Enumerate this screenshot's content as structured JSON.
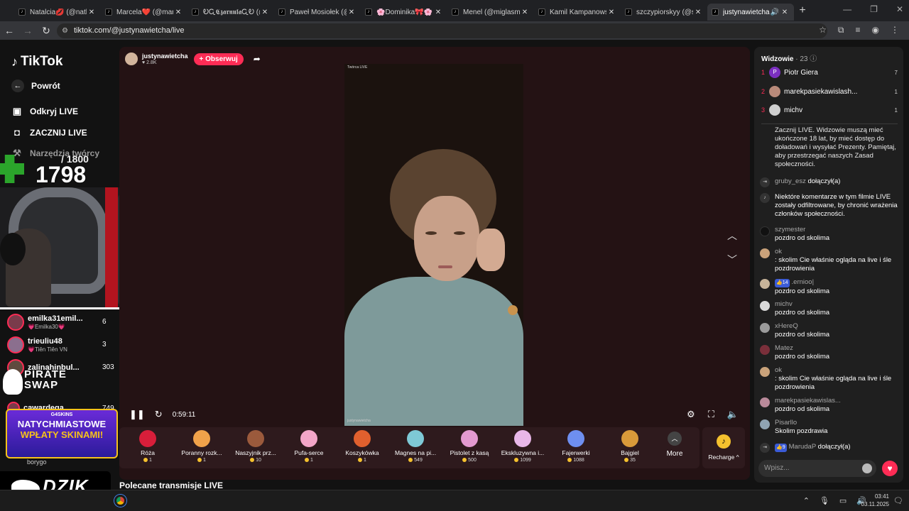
{
  "browser": {
    "tabs": [
      {
        "label": "Natalcia💋 (@natka"
      },
      {
        "label": "Marcela❤️ (@marcel"
      },
      {
        "label": "ᎧᏩ𝕮𝖟𝖆𝖗𝖓𝖚𝖑𝖆ᏩᎧ (@"
      },
      {
        "label": "Paweł Mosiołek (@pa"
      },
      {
        "label": "🌸Dominika🎀🌸"
      },
      {
        "label": "Menel (@miglasmig"
      },
      {
        "label": "Kamil Kampanowski ("
      },
      {
        "label": "szczypiorskyy (@szcz"
      },
      {
        "label": "justynawietcha (@"
      }
    ],
    "url": "tiktok.com/@justynawietcha/live"
  },
  "sidebar": {
    "logo": "TikTok",
    "back": "Powrót",
    "nav": [
      {
        "label": "Odkryj LIVE"
      },
      {
        "label": "ZACZNIJ LIVE"
      },
      {
        "label": "Narzędzia twórcy"
      }
    ],
    "counter_target": "/ 1800",
    "counter_value": "1798",
    "live_users": [
      {
        "name": "emilka31emil...",
        "sub": "💗Emilka30💗",
        "count": "6"
      },
      {
        "name": "trieuliu48",
        "sub": "💗Tiên Tiên VN",
        "count": "3"
      },
      {
        "name": "zalinahinbul...",
        "sub": "",
        "count": "303"
      },
      {
        "name": "cawardega",
        "sub": "",
        "count": "749"
      }
    ],
    "pirate_line1": "PIRATE",
    "pirate_line2": "SWAP",
    "banner_brand": "G4SKINS",
    "banner_line1": "NATYCHMIASTOWE",
    "banner_line2": "WPŁATY SKINAMI!",
    "borygo": "borygo",
    "dzik": "DZIK."
  },
  "stream": {
    "host_name": "justynawietcha",
    "host_likes": "♥ 2.8K",
    "follow": "+ Obserwuj",
    "badge": "Twórca LIVE",
    "credit": "justynawietcha",
    "time": "0:59:11"
  },
  "gifts": [
    {
      "name": "Róża",
      "price": "1",
      "color": "#d81e3a"
    },
    {
      "name": "Poranny rozk...",
      "price": "1",
      "color": "#f0a24a"
    },
    {
      "name": "Naszyjnik prz...",
      "price": "10",
      "color": "#9b5a3c"
    },
    {
      "name": "Pufa-serce",
      "price": "1",
      "color": "#f3a6c8"
    },
    {
      "name": "Koszykówka",
      "price": "1",
      "color": "#e0602e"
    },
    {
      "name": "Magnes na pi...",
      "price": "549",
      "color": "#7ec9d6"
    },
    {
      "name": "Pistolet z kasą",
      "price": "500",
      "color": "#e39ad0"
    },
    {
      "name": "Ekskluzywna i...",
      "price": "1099",
      "color": "#e8b7e8"
    },
    {
      "name": "Fajerwerki",
      "price": "1088",
      "color": "#6e8ff0"
    },
    {
      "name": "Bajgiel",
      "price": "35",
      "color": "#d99a3a"
    }
  ],
  "more": "More",
  "recharge": "Recharge ^",
  "polecane": "Polecane transmisje LIVE",
  "chat": {
    "viewers_label": "Widzowie",
    "viewers_count": "· 23",
    "top_viewers": [
      {
        "rank": "1",
        "name": "Piotr Giera",
        "count": "7",
        "color": "#7b2fbf"
      },
      {
        "rank": "2",
        "name": "marekpasiekawislash...",
        "count": "1",
        "color": "#b98a7a"
      },
      {
        "rank": "3",
        "name": "michv",
        "count": "1",
        "color": "#cfcfcf"
      }
    ],
    "messages": [
      {
        "user": "",
        "text": "Zacznij LIVE. Widzowie muszą mieć ukończone 18 lat, by mieć dostęp do doładowań i wysyłać Prezenty. Pamiętaj, aby przestrzegać naszych Zasad społeczności.",
        "kind": "sys"
      },
      {
        "user": "gruby_esz",
        "text": "dołączył(a)",
        "kind": "join"
      },
      {
        "user": "",
        "text": "Niektóre komentarze w tym filmie LIVE zostały odfiltrowane, by chronić wrażenia członków społeczności.",
        "kind": "sys"
      },
      {
        "user": "szymester",
        "text": "pozdro od skolima",
        "kind": "msg",
        "color": "#111"
      },
      {
        "user": "ok",
        "text": ": skolim Cie właśnie ogląda na live i śle pozdrowienia",
        "kind": "msg",
        "color": "#c9a27a"
      },
      {
        "user": ".ernioo|",
        "badge": "14",
        "text": "pozdro od skolima",
        "kind": "msg",
        "color": "#c7b49a"
      },
      {
        "user": "michv",
        "text": "pozdro od skolima",
        "kind": "msg",
        "color": "#d9d9d9"
      },
      {
        "user": "xHereQ",
        "text": "pozdro od skolima",
        "kind": "msg",
        "color": "#9a9a9a"
      },
      {
        "user": "Matez",
        "text": "pozdro od skolima",
        "kind": "msg",
        "color": "#7a2f3a"
      },
      {
        "user": "ok",
        "text": ": skolim Cie właśnie ogląda na live i śle pozdrowienia",
        "kind": "msg",
        "color": "#c9a27a"
      },
      {
        "user": "marekpasiekawislas...",
        "text": "pozdro od skolima",
        "kind": "msg",
        "color": "#b98a9a"
      },
      {
        "user": "Pisarllo",
        "text": "Skolim pozdrawia",
        "kind": "msg",
        "color": "#8fa4b3"
      },
      {
        "user": "MarudaP",
        "badge": "9",
        "text": "dołączył(a)",
        "kind": "join"
      }
    ],
    "input_placeholder": "Wpisz..."
  },
  "taskbar": {
    "time": "03:41",
    "date": "03.11.2025"
  }
}
